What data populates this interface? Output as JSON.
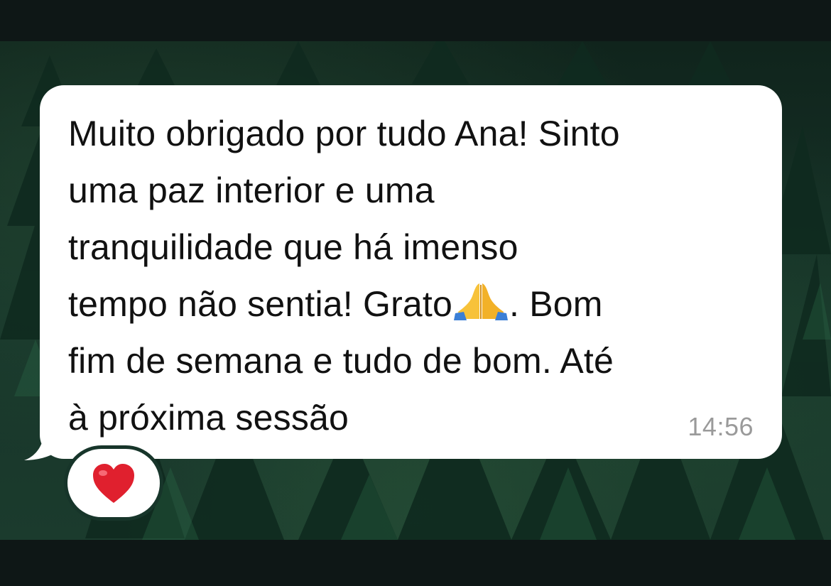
{
  "message": {
    "line1": "Muito obrigado por tudo Ana! Sinto",
    "line2": "uma paz interior e uma",
    "line3": "tranquilidade que há imenso",
    "line4_before_emoji": "tempo não sentia! Grato",
    "emoji_icon": "folded-hands-icon",
    "line4_after_emoji": ". Bom",
    "line5": "fim de semana e tudo de bom. Até",
    "line6": "à próxima sessão",
    "time": "14:56"
  },
  "reaction": {
    "icon": "red-heart-icon",
    "color": "#e0202e"
  },
  "colors": {
    "bubble": "#ffffff",
    "text": "#111111",
    "timestamp": "#9a9a9a",
    "wallpaper": "#17352a"
  }
}
